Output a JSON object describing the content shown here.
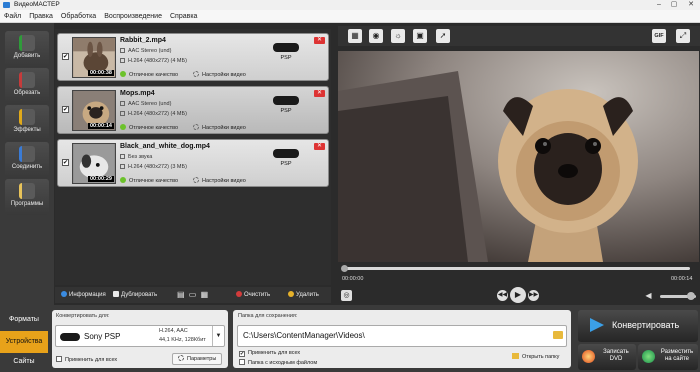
{
  "window": {
    "title": "ВидеоМАСТЕР",
    "minimize": "–",
    "maximize": "▢",
    "close": "✕"
  },
  "menu": [
    "Файл",
    "Правка",
    "Обработка",
    "Воспроизведение",
    "Справка"
  ],
  "left_toolbar": [
    {
      "label": "Добавить",
      "icon": "add-film-icon",
      "color": "#2f9b3a"
    },
    {
      "label": "Обрезать",
      "icon": "scissors-icon",
      "color": "#c63b3b"
    },
    {
      "label": "Эффекты",
      "icon": "effects-icon",
      "color": "#e0a91a"
    },
    {
      "label": "Соединить",
      "icon": "join-icon",
      "color": "#3a7bd5"
    },
    {
      "label": "Программы",
      "icon": "programs-icon",
      "color": "#e8c35a"
    }
  ],
  "files": [
    {
      "name": "Rabbit_2.mp4",
      "audio": "AAC Stereo (und)",
      "video": "H.264 (480x272) (4 МБ)",
      "duration": "00:00:38",
      "quality": "Отличное качество",
      "settings": "Настройки видео",
      "device": "PSP",
      "checked": true
    },
    {
      "name": "Mops.mp4",
      "audio": "AAC Stereo (und)",
      "video": "H.264 (480x272) (4 МБ)",
      "duration": "00:00:14",
      "quality": "Отличное качество",
      "settings": "Настройки видео",
      "device": "PSP",
      "checked": true
    },
    {
      "name": "Black_and_white_dog.mp4",
      "audio": "Без звука",
      "video": "H.264 (480x272) (3 МБ)",
      "duration": "00:00:29",
      "quality": "Отличное качество",
      "settings": "Настройки видео",
      "device": "PSP",
      "checked": true
    }
  ],
  "list_bar": {
    "info": "Информация",
    "duplicate": "Дублировать",
    "clear": "Очистить",
    "delete": "Удалить"
  },
  "player": {
    "toolbar_icons": [
      "film-strip-icon",
      "snapshot-icon",
      "brightness-icon",
      "video-settings-icon",
      "speed-icon"
    ],
    "gif_label": "GIF",
    "time_start": "00:00:00",
    "time_end": "00:00:14",
    "progress": 0,
    "volume": 0.85
  },
  "bottom": {
    "tabs": [
      "Форматы",
      "Устройства",
      "Сайты"
    ],
    "active_tab": "Устройства",
    "convert_for_label": "Конвертировать для:",
    "device_name": "Sony PSP",
    "device_codec": "H.264, AAC",
    "device_audio": "44,1 KHz, 128Кбит",
    "apply_all": "Применить для всех",
    "params": "Параметры",
    "save_folder_label": "Папка для сохранения:",
    "save_path": "C:\\Users\\ContentManager\\Videos\\",
    "apply_all_2": "Применить для всех",
    "source_folder": "Папка с исходным файлом",
    "open_folder": "Открыть папку",
    "convert": "Конвертировать",
    "burn_dvd": "Записать DVD",
    "publish": "Разместить на сайте"
  }
}
